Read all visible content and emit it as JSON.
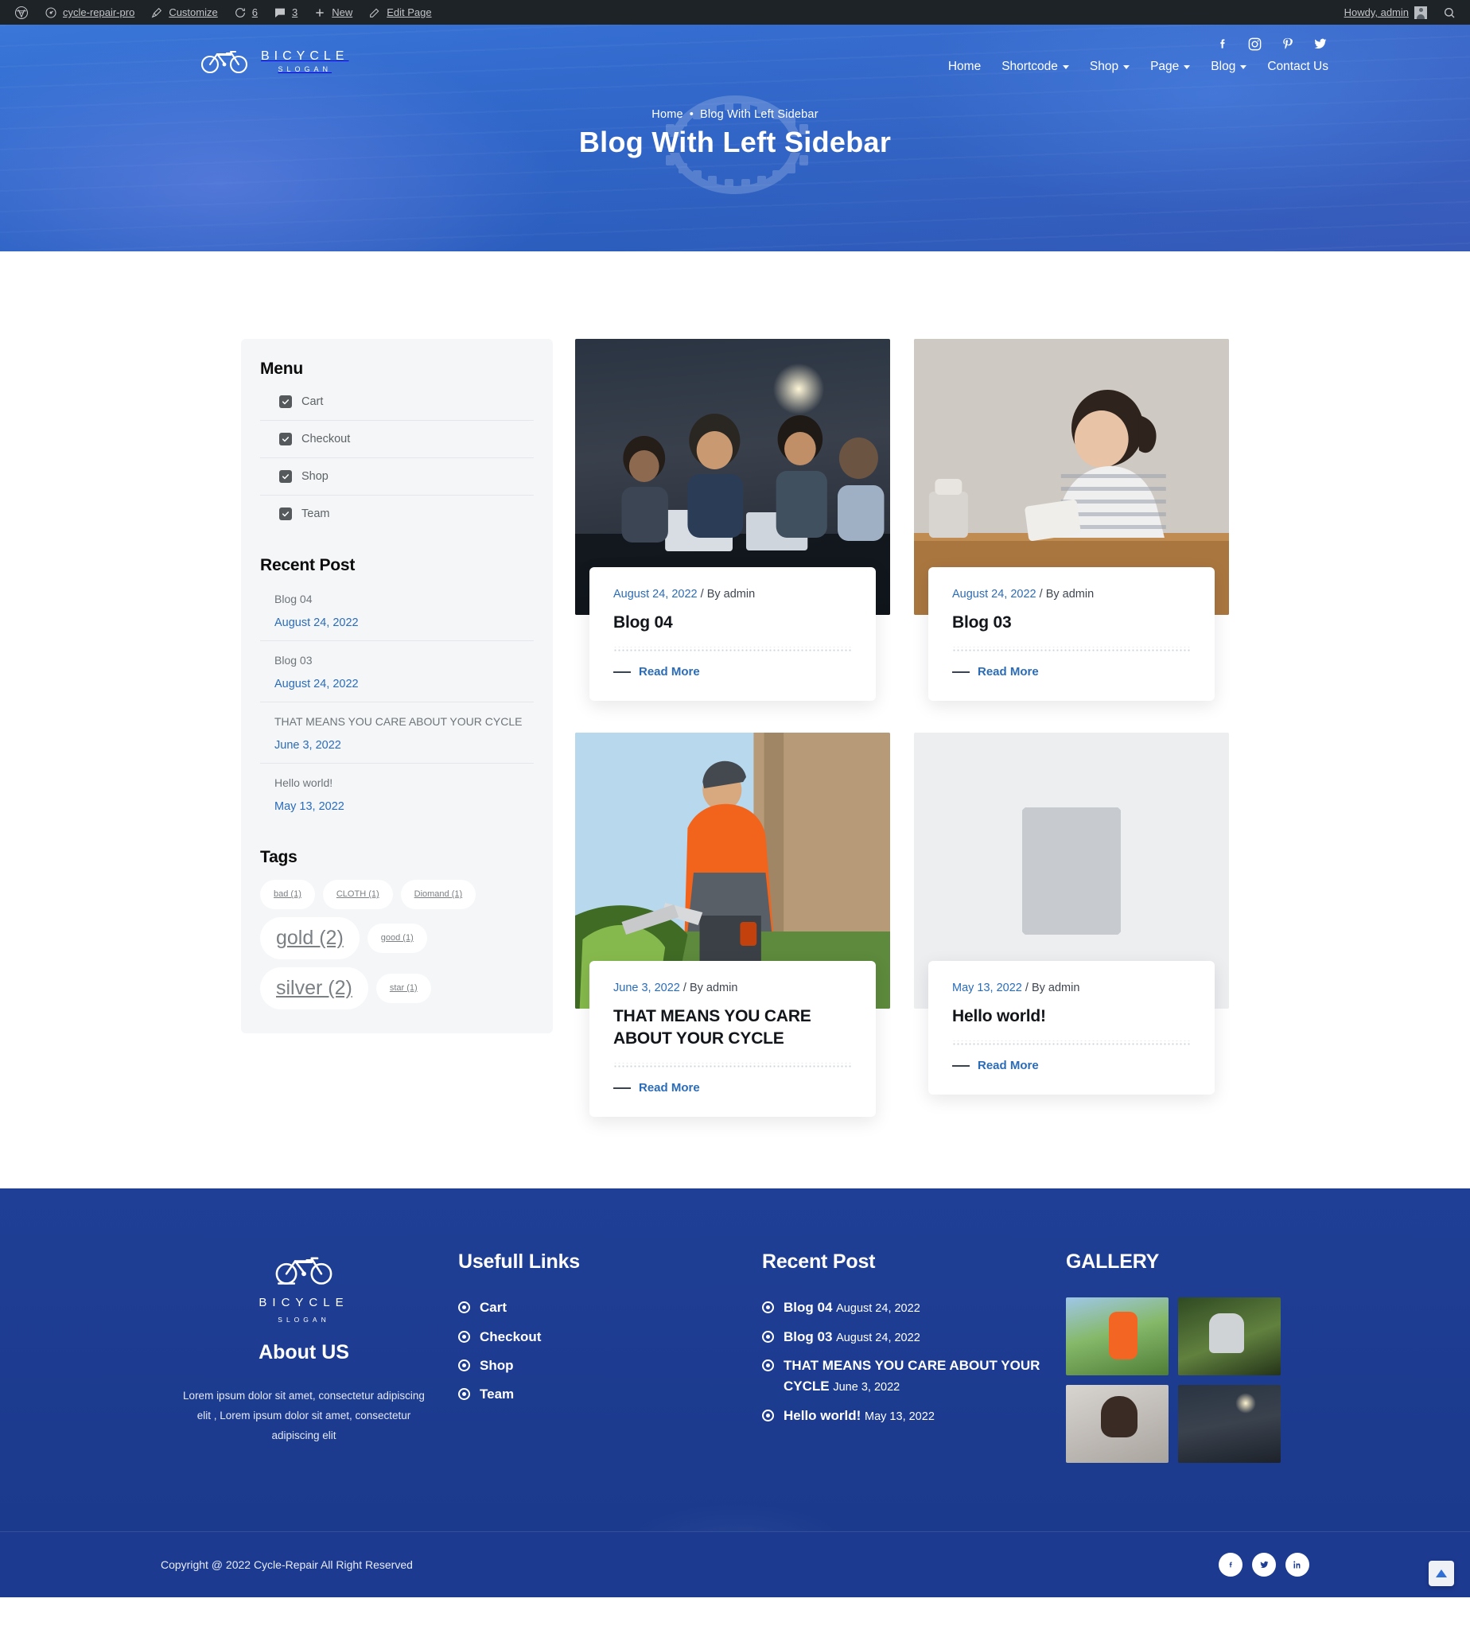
{
  "admin_bar": {
    "wp_logo_icon": "wordpress-icon",
    "site_name": "cycle-repair-pro",
    "site_icon": "dashboard-icon",
    "customize": "Customize",
    "customize_icon": "paintbrush-icon",
    "updates_count": "6",
    "updates_icon": "update-icon",
    "comments_count": "3",
    "comments_icon": "comment-bubble-icon",
    "new": "New",
    "new_icon": "plus-icon",
    "edit_page": "Edit Page",
    "edit_icon": "pencil-icon",
    "howdy": "Howdy, admin",
    "avatar_icon": "user-avatar-icon",
    "search_icon": "search-icon"
  },
  "header": {
    "logo": {
      "name": "BICYCLE",
      "slogan": "SLOGAN",
      "icon": "bicycle-icon"
    },
    "social": [
      {
        "name": "facebook-icon",
        "label": "Facebook"
      },
      {
        "name": "instagram-icon",
        "label": "Instagram"
      },
      {
        "name": "pinterest-icon",
        "label": "Pinterest"
      },
      {
        "name": "twitter-icon",
        "label": "Twitter"
      }
    ],
    "nav": [
      {
        "label": "Home",
        "has_submenu": false
      },
      {
        "label": "Shortcode",
        "has_submenu": true
      },
      {
        "label": "Shop",
        "has_submenu": true
      },
      {
        "label": "Page",
        "has_submenu": true
      },
      {
        "label": "Blog",
        "has_submenu": true
      },
      {
        "label": "Contact Us",
        "has_submenu": false
      }
    ]
  },
  "hero": {
    "breadcrumb_home": "Home",
    "breadcrumb_separator": "•",
    "breadcrumb_current": "Blog With Left Sidebar",
    "title": "Blog With Left Sidebar",
    "gear_icon": "gear-decoration-icon"
  },
  "sidebar": {
    "menu": {
      "title": "Menu",
      "items": [
        {
          "label": "Cart",
          "checked": true
        },
        {
          "label": "Checkout",
          "checked": true
        },
        {
          "label": "Shop",
          "checked": true
        },
        {
          "label": "Team",
          "checked": true
        }
      ]
    },
    "recent_post": {
      "title": "Recent Post",
      "items": [
        {
          "title": "Blog 04",
          "date": "August 24, 2022"
        },
        {
          "title": "Blog 03",
          "date": "August 24, 2022"
        },
        {
          "title": "THAT MEANS YOU CARE ABOUT YOUR CYCLE",
          "date": "June 3, 2022"
        },
        {
          "title": "Hello world!",
          "date": "May 13, 2022"
        }
      ]
    },
    "tags": {
      "title": "Tags",
      "items": [
        {
          "label": "bad (1)",
          "size": "s"
        },
        {
          "label": "CLOTH (1)",
          "size": "s"
        },
        {
          "label": "Diomand (1)",
          "size": "s"
        },
        {
          "label": "gold (2)",
          "size": "l"
        },
        {
          "label": "good (1)",
          "size": "s"
        },
        {
          "label": "silver (2)",
          "size": "l"
        },
        {
          "label": "star (1)",
          "size": "s"
        }
      ]
    }
  },
  "posts": [
    {
      "date": "August 24, 2022",
      "author": "/ By admin",
      "title": "Blog 04",
      "read_more": "Read More",
      "image": "meeting-photo",
      "image_kind": "photo"
    },
    {
      "date": "August 24, 2022",
      "author": "/ By admin",
      "title": "Blog 03",
      "read_more": "Read More",
      "image": "woman-at-desk-photo",
      "image_kind": "photo"
    },
    {
      "date": "June 3, 2022",
      "author": "/ By admin",
      "title": "THAT MEANS YOU CARE ABOUT YOUR CYCLE",
      "read_more": "Read More",
      "image": "gardener-photo",
      "image_kind": "photo"
    },
    {
      "date": "May 13, 2022",
      "author": "/ By admin",
      "title": "Hello world!",
      "read_more": "Read More",
      "image": "image-placeholder-icon",
      "image_kind": "placeholder"
    }
  ],
  "footer": {
    "logo": {
      "name": "BICYCLE",
      "slogan": "SLOGAN",
      "icon": "bicycle-icon"
    },
    "about_title": "About US",
    "about_text": "Lorem ipsum dolor sit amet, consectetur adipiscing elit , Lorem ipsum dolor sit amet, consectetur adipiscing elit",
    "useful_links": {
      "title": "Usefull Links",
      "items": [
        {
          "label": "Cart"
        },
        {
          "label": "Checkout"
        },
        {
          "label": "Shop"
        },
        {
          "label": "Team"
        }
      ]
    },
    "recent_post": {
      "title": "Recent Post",
      "items": [
        {
          "title": "Blog 04",
          "date": "August 24, 2022"
        },
        {
          "title": "Blog 03",
          "date": "August 24, 2022"
        },
        {
          "title": "THAT MEANS YOU CARE ABOUT YOUR CYCLE",
          "date": "June 3, 2022"
        },
        {
          "title": "Hello world!",
          "date": "May 13, 2022"
        }
      ]
    },
    "gallery": {
      "title": "GALLERY",
      "items": [
        {
          "name": "gardener-thumb"
        },
        {
          "name": "bike-mechanic-thumb"
        },
        {
          "name": "woman-desk-thumb"
        },
        {
          "name": "meeting-thumb"
        }
      ]
    },
    "copyright": "Copyright @ 2022 Cycle-Repair All Right Reserved",
    "copy_social": [
      {
        "name": "facebook-icon"
      },
      {
        "name": "twitter-icon"
      },
      {
        "name": "linkedin-icon"
      }
    ],
    "back_to_top_icon": "back-to-top-icon"
  },
  "colors": {
    "brand_blue": "#2f6fd6",
    "footer_blue": "#1f3f96",
    "link_blue": "#2b6cb8",
    "admin_bar": "#1d2327"
  }
}
